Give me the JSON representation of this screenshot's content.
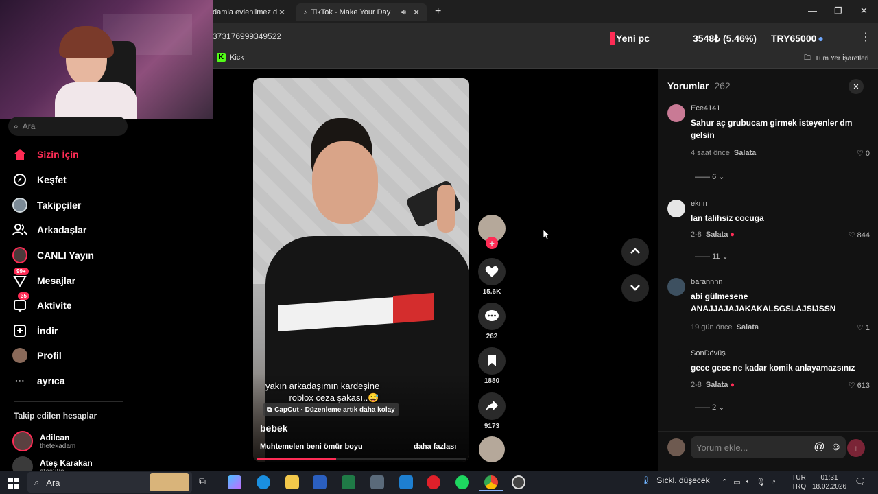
{
  "browser": {
    "tab1_title": "damla evlenilmez d",
    "tab2_title": "TikTok - Make Your Day",
    "url": "373176999349522",
    "bookmark": "Kick",
    "all_bookmarks": "Tüm Yer İşaretleri"
  },
  "ticker": {
    "label": "Yeni pc",
    "value": "3548₺ (5.46%)",
    "goal": "TRY65000"
  },
  "sidebar": {
    "search_placeholder": "Ara",
    "items": [
      {
        "label": "Sizin İçin"
      },
      {
        "label": "Keşfet"
      },
      {
        "label": "Takipçiler"
      },
      {
        "label": "Arkadaşlar"
      },
      {
        "label": "CANLI Yayın"
      },
      {
        "label": "Mesajlar",
        "badge": "99+"
      },
      {
        "label": "Aktivite",
        "badge": "35"
      },
      {
        "label": "İndir"
      },
      {
        "label": "Profil"
      },
      {
        "label": "ayrıca"
      }
    ],
    "following_title": "Takip edilen hesaplar",
    "accounts": [
      {
        "name": "Adilcan",
        "handle": "thetekadam"
      },
      {
        "name": "Ateş Karakan",
        "handle": "ates38o"
      }
    ]
  },
  "video": {
    "caption_line1": "yakın arkadaşımın kardeşine",
    "caption_line2": "roblox ceza şakası..😅",
    "capcut": "CapCut · Düzenleme artık daha kolay",
    "author": "bebek",
    "description": "Muhtemelen beni ömür boyu",
    "more": "daha fazlası",
    "progress": 0.38
  },
  "actions": {
    "likes": "15.6K",
    "comments": "262",
    "saves": "1880",
    "shares": "9173"
  },
  "comments_panel": {
    "title": "Yorumlar",
    "count": "262",
    "input_placeholder": "Yorum ekle...",
    "items": [
      {
        "user": "Ece4141",
        "text": "Sahur aç grubucam girmek isteyenler dm gelsin",
        "time": "4 saat önce",
        "salata": "Salata",
        "likes": "0",
        "replies": "6"
      },
      {
        "user": "ekrin",
        "text": "lan talihsiz cocuga",
        "time": "2-8",
        "salata": "Salata",
        "likes": "844",
        "replies": "11"
      },
      {
        "user": "barannnn",
        "text": "abi gülmesene ANAJJAJAJAKAKALSGSLAJSIJSSN",
        "time": "19 gün önce",
        "salata": "Salata",
        "likes": "1",
        "replies": ""
      },
      {
        "user": "SonDövüş",
        "text": "gece gece ne kadar komik anlayamazsınız",
        "time": "2-8",
        "salata": "Salata",
        "likes": "613",
        "replies": "2"
      }
    ]
  },
  "taskbar": {
    "search": "Ara",
    "weather": "Sıckl. düşecek",
    "lang1": "TUR",
    "lang2": "TRQ",
    "time": "01:31",
    "date": "18.02.2026"
  },
  "colors": {
    "accent": "#fe2c55",
    "panel": "#121212"
  }
}
